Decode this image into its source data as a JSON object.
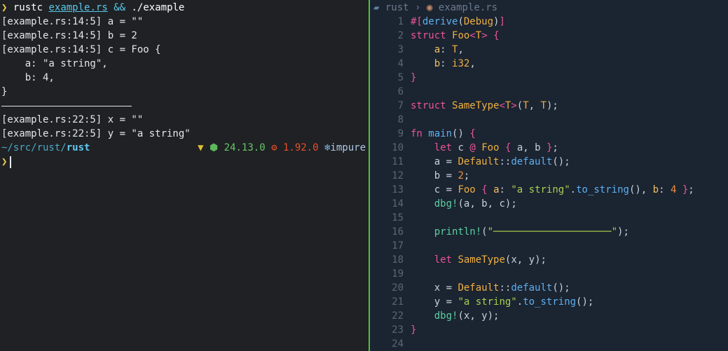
{
  "terminal": {
    "command": {
      "prompt": "❯",
      "program": "rustc",
      "file": "example.rs",
      "op": "&&",
      "run": "./example"
    },
    "output": [
      "[example.rs:14:5] a = \"\"",
      "[example.rs:14:5] b = 2",
      "[example.rs:14:5] c = Foo {",
      "    a: \"a string\",",
      "    b: 4,",
      "}"
    ],
    "output2": [
      "[example.rs:22:5] x = \"\"",
      "[example.rs:22:5] y = \"a string\""
    ],
    "status": {
      "path_prefix": "~/src/rust/",
      "path_current": "rust",
      "node_version": "24.13.0",
      "rust_version": "1.92.0",
      "nix": "impure"
    },
    "prompt2": "❯"
  },
  "editor": {
    "breadcrumb": {
      "folder": "rust",
      "sep": "›",
      "file": "example.rs"
    }
  },
  "colors": {
    "terminal_bg": "#1f2124",
    "editor_bg": "#1b2431",
    "divider": "#4fc13c"
  }
}
